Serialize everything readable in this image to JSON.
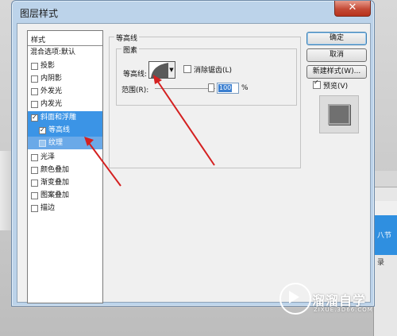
{
  "window": {
    "title": "图层样式",
    "close_glyph": "✕"
  },
  "styles_list": {
    "header": "样式",
    "blend_options": "混合选项:默认",
    "items": [
      {
        "label": "投影",
        "checked": false
      },
      {
        "label": "内阴影",
        "checked": false
      },
      {
        "label": "外发光",
        "checked": false
      },
      {
        "label": "内发光",
        "checked": false
      },
      {
        "label": "斜面和浮雕",
        "checked": true
      },
      {
        "label": "等高线",
        "checked": true
      },
      {
        "label": "纹理",
        "checked": false
      },
      {
        "label": "光泽",
        "checked": false
      },
      {
        "label": "颜色叠加",
        "checked": false
      },
      {
        "label": "渐变叠加",
        "checked": false
      },
      {
        "label": "图案叠加",
        "checked": false
      },
      {
        "label": "描边",
        "checked": false
      }
    ]
  },
  "contour_panel": {
    "group_title": "等高线",
    "inner_title": "图素",
    "contour_label": "等高线:",
    "antialias_label": "消除锯齿(L)",
    "antialias_checked": false,
    "range_label": "范围(R):",
    "range_value": "100",
    "range_unit": "%"
  },
  "buttons": {
    "ok": "确定",
    "cancel": "取消",
    "new_style": "新建样式(W)..."
  },
  "preview": {
    "label": "预览(V)",
    "checked": true
  },
  "background_panel": {
    "selected_text": "八节",
    "bottom_text": "录"
  },
  "watermark": {
    "brand": "溜溜自学",
    "url": "ZIXUE.3D66.COM"
  },
  "colors": {
    "accent_selection": "#3b94e6",
    "arrow_red": "#d42020",
    "dialog_frame": "#bcd3ea"
  },
  "icons": [
    "close-icon",
    "dropdown-arrow-icon",
    "lock-icon",
    "mail-icon",
    "play-icon",
    "contour-curve-icon"
  ]
}
